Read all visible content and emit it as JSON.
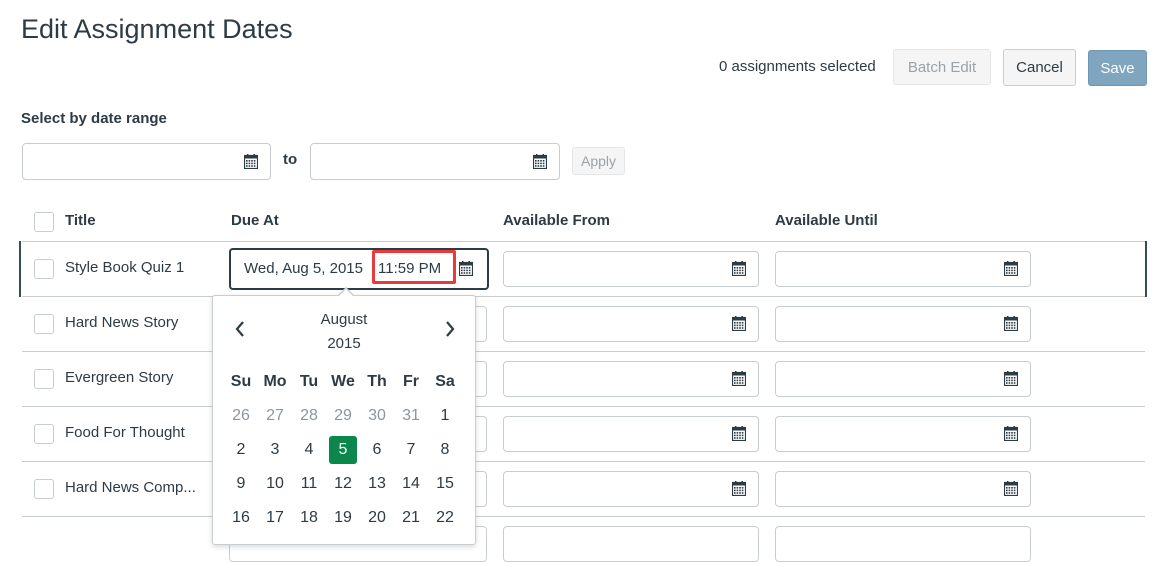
{
  "header": {
    "title": "Edit Assignment Dates",
    "selected_count": "0 assignments selected",
    "batch_edit": "Batch Edit",
    "cancel": "Cancel",
    "save": "Save"
  },
  "date_range": {
    "label": "Select by date range",
    "to": "to",
    "apply": "Apply",
    "start_value": "",
    "end_value": ""
  },
  "table": {
    "columns": [
      "Title",
      "Due At",
      "Available From",
      "Available Until"
    ],
    "rows": [
      {
        "title": "Style Book Quiz 1",
        "due_date": "Wed, Aug 5, 2015",
        "due_time": "11:59 PM",
        "available_from": "",
        "available_until": ""
      },
      {
        "title": "Hard News Story",
        "due": "",
        "available_from": "",
        "available_until": ""
      },
      {
        "title": "Evergreen Story",
        "due": "",
        "available_from": "",
        "available_until": ""
      },
      {
        "title": "Food For Thought",
        "due": "",
        "available_from": "",
        "available_until": ""
      },
      {
        "title": "Hard News Comp...",
        "due": "",
        "available_from": "",
        "available_until": ""
      }
    ]
  },
  "datepicker": {
    "month": "August",
    "year": "2015",
    "weekdays": [
      "Su",
      "Mo",
      "Tu",
      "We",
      "Th",
      "Fr",
      "Sa"
    ],
    "weeks": [
      [
        "26",
        "27",
        "28",
        "29",
        "30",
        "31",
        "1"
      ],
      [
        "2",
        "3",
        "4",
        "5",
        "6",
        "7",
        "8"
      ],
      [
        "9",
        "10",
        "11",
        "12",
        "13",
        "14",
        "15"
      ],
      [
        "16",
        "17",
        "18",
        "19",
        "20",
        "21",
        "22"
      ]
    ],
    "selected_day": "5",
    "prev": "‹",
    "next": "›"
  },
  "colors": {
    "selected_day": "#0b874b",
    "highlight": "#e8393d",
    "save_button": "#80a5bf"
  },
  "icons": {
    "calendar": "calendar-icon",
    "checkbox": "checkbox"
  }
}
